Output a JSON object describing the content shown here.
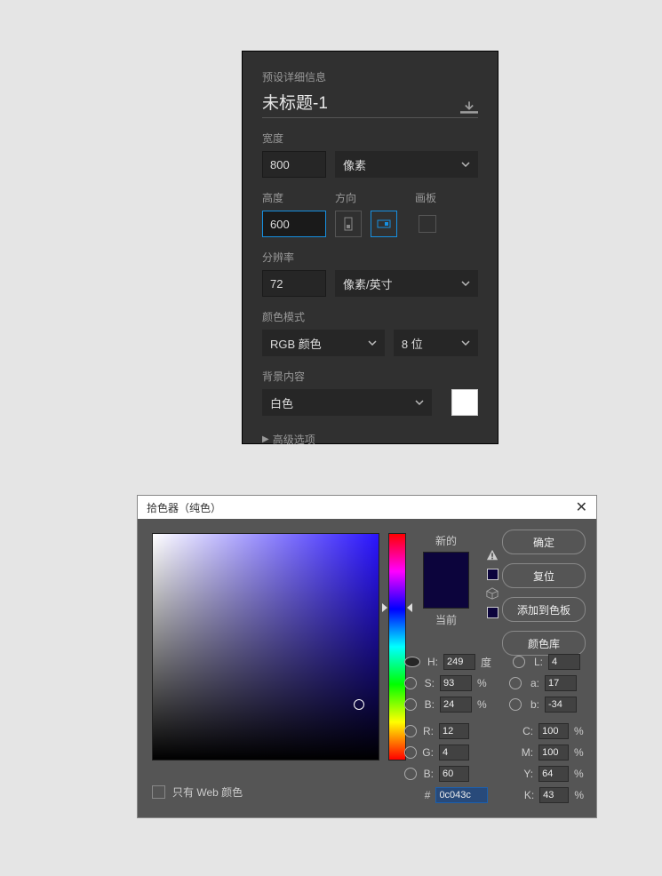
{
  "panel1": {
    "preset_label": "预设详细信息",
    "title": "未标题-1",
    "width_label": "宽度",
    "width_value": "800",
    "width_unit": "像素",
    "height_label": "高度",
    "height_value": "600",
    "orient_label": "方向",
    "artboard_label": "画板",
    "resolution_label": "分辨率",
    "resolution_value": "72",
    "resolution_unit": "像素/英寸",
    "colormode_label": "颜色模式",
    "colormode_value": "RGB 颜色",
    "bitdepth_value": "8 位",
    "bg_label": "背景内容",
    "bg_value": "白色",
    "advanced_label": "高级选项"
  },
  "picker": {
    "title": "拾色器（纯色）",
    "ok": "确定",
    "reset": "复位",
    "add_swatch": "添加到色板",
    "color_lib": "颜色库",
    "new_label": "新的",
    "current_label": "当前",
    "web_only": "只有 Web 颜色",
    "hex_prefix": "#",
    "hex": "0c043c",
    "H": {
      "label": "H:",
      "value": "249",
      "unit": "度"
    },
    "S": {
      "label": "S:",
      "value": "93",
      "unit": "%"
    },
    "Bv": {
      "label": "B:",
      "value": "24",
      "unit": "%"
    },
    "R": {
      "label": "R:",
      "value": "12"
    },
    "G": {
      "label": "G:",
      "value": "4"
    },
    "Bc": {
      "label": "B:",
      "value": "60"
    },
    "L": {
      "label": "L:",
      "value": "4"
    },
    "a": {
      "label": "a:",
      "value": "17"
    },
    "b": {
      "label": "b:",
      "value": "-34"
    },
    "C": {
      "label": "C:",
      "value": "100",
      "unit": "%"
    },
    "M": {
      "label": "M:",
      "value": "100",
      "unit": "%"
    },
    "Y": {
      "label": "Y:",
      "value": "64",
      "unit": "%"
    },
    "K": {
      "label": "K:",
      "value": "43",
      "unit": "%"
    }
  }
}
